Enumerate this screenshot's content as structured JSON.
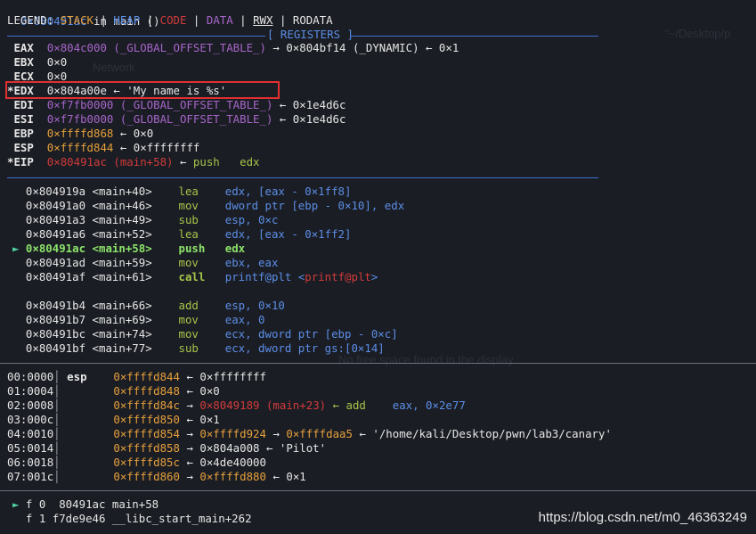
{
  "header": {
    "location_addr": "0×080491ac",
    "location_rest": " in main ()"
  },
  "legend": {
    "label": "LEGEND: ",
    "items": [
      {
        "text": "STACK",
        "color": "#e5a03c"
      },
      {
        "text": "HEAP",
        "color": "#5b8ee6"
      },
      {
        "text": "CODE",
        "color": "#d13b3b"
      },
      {
        "text": "DATA",
        "color": "#a665c9"
      },
      {
        "text": "RWX",
        "color": "#e6e6e6"
      },
      {
        "text": "RODATA",
        "color": "#e6e6e6"
      }
    ],
    "sep": " | "
  },
  "background_ghost": {
    "network": "Network",
    "path": "\"~/Desktop/p",
    "dialog": "No free space found in the display"
  },
  "registers": {
    "title": "[ REGISTERS ]",
    "rows": [
      {
        "mark": " ",
        "name": "EAX",
        "value": "0×804c000 (_GLOBAL_OFFSET_TABLE_)",
        "value_class": "purple",
        "rest": " → 0×804bf14 (_DYNAMIC) ← 0×1"
      },
      {
        "mark": " ",
        "name": "EBX",
        "value": "0×0",
        "value_class": "white",
        "rest": ""
      },
      {
        "mark": " ",
        "name": "ECX",
        "value": "0×0",
        "value_class": "white",
        "rest": ""
      },
      {
        "mark": "*",
        "name": "EDX",
        "value": "0×804a00e",
        "value_class": "white",
        "rest": " ← 'My name is %s'"
      },
      {
        "mark": " ",
        "name": "EDI",
        "value": "0×f7fb0000 (_GLOBAL_OFFSET_TABLE_)",
        "value_class": "purple",
        "rest": " ← 0×1e4d6c"
      },
      {
        "mark": " ",
        "name": "ESI",
        "value": "0×f7fb0000 (_GLOBAL_OFFSET_TABLE_)",
        "value_class": "purple",
        "rest": " ← 0×1e4d6c"
      },
      {
        "mark": " ",
        "name": "EBP",
        "value": "0×ffffd868",
        "value_class": "orange",
        "rest": " ← 0×0"
      },
      {
        "mark": " ",
        "name": "ESP",
        "value": "0×ffffd844",
        "value_class": "orange",
        "rest": " ← 0×ffffffff"
      },
      {
        "mark": "*",
        "name": "EIP",
        "value": "0×80491ac (main+58)",
        "value_class": "red",
        "rest_green": " ← push   edx"
      }
    ]
  },
  "disasm": {
    "rows": [
      {
        "marker": " ",
        "addr": "0×804919a",
        "sym": "<main+40>",
        "op": "lea",
        "args": "edx, [eax - 0×1ff8]"
      },
      {
        "marker": " ",
        "addr": "0×80491a0",
        "sym": "<main+46>",
        "op": "mov",
        "args": "dword ptr [ebp - 0×10], edx"
      },
      {
        "marker": " ",
        "addr": "0×80491a3",
        "sym": "<main+49>",
        "op": "sub",
        "args": "esp, 0×c"
      },
      {
        "marker": " ",
        "addr": "0×80491a6",
        "sym": "<main+52>",
        "op": "lea",
        "args": "edx, [eax - 0×1ff2]"
      },
      {
        "marker": "►",
        "addr": "0×80491ac",
        "sym": "<main+58>",
        "op": "push",
        "args": "edx",
        "current": true
      },
      {
        "marker": " ",
        "addr": "0×80491ad",
        "sym": "<main+59>",
        "op": "mov",
        "args": "ebx, eax"
      },
      {
        "marker": " ",
        "addr": "0×80491af",
        "sym": "<main+61>",
        "op": "call",
        "args": "printf@plt <",
        "args_red": "printf@plt",
        "args_tail": ">",
        "call": true
      },
      {
        "blank": true
      },
      {
        "marker": " ",
        "addr": "0×80491b4",
        "sym": "<main+66>",
        "op": "add",
        "args": "esp, 0×10"
      },
      {
        "marker": " ",
        "addr": "0×80491b7",
        "sym": "<main+69>",
        "op": "mov",
        "args": "eax, 0"
      },
      {
        "marker": " ",
        "addr": "0×80491bc",
        "sym": "<main+74>",
        "op": "mov",
        "args": "ecx, dword ptr [ebp - 0×c]"
      },
      {
        "marker": " ",
        "addr": "0×80491bf",
        "sym": "<main+77>",
        "op": "sub",
        "args": "ecx, dword ptr gs:[0×14]"
      }
    ]
  },
  "stack": {
    "rows": [
      {
        "idx": "00:0000",
        "reg": "esp",
        "addr": "0×ffffd844",
        "rest": " ← 0×ffffffff"
      },
      {
        "idx": "01:0004",
        "reg": "",
        "addr": "0×ffffd848",
        "rest": " ← 0×0"
      },
      {
        "idx": "02:0008",
        "reg": "",
        "addr": "0×ffffd84c",
        "rest_arrow": " → ",
        "rest_red": "0×8049189 (main+23)",
        "rest_green": " ← add    ",
        "rest_tail": "eax, 0×2e77"
      },
      {
        "idx": "03:000c",
        "reg": "",
        "addr": "0×ffffd850",
        "rest": " ← 0×1"
      },
      {
        "idx": "04:0010",
        "reg": "",
        "addr": "0×ffffd854",
        "rest_arrow": " → ",
        "rest_orange": "0×ffffd924",
        "rest_arrow2": " → ",
        "rest_orange2": "0×ffffdaa5",
        "rest": " ← '/home/kali/Desktop/pwn/lab3/canary'"
      },
      {
        "idx": "05:0014",
        "reg": "",
        "addr": "0×ffffd858",
        "rest": " → 0×804a008 ← 'Pilot'"
      },
      {
        "idx": "06:0018",
        "reg": "",
        "addr": "0×ffffd85c",
        "rest": " ← 0×4de40000"
      },
      {
        "idx": "07:001c",
        "reg": "",
        "addr": "0×ffffd860",
        "rest_arrow": " → ",
        "rest_orange": "0×ffffd880",
        "rest": " ← 0×1"
      }
    ]
  },
  "backtrace": {
    "rows": [
      {
        "marker": "►",
        "text": " f 0  80491ac main+58"
      },
      {
        "marker": " ",
        "text": " f 1 f7de9e46 __libc_start_main+262"
      }
    ]
  },
  "watermark": "https://blog.csdn.net/m0_46363249"
}
